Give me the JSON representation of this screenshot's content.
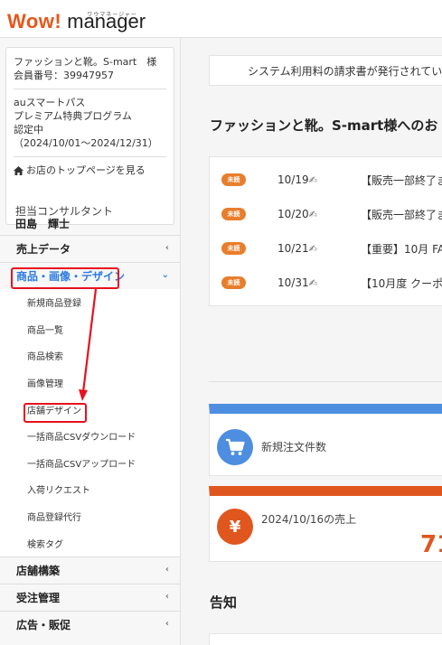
{
  "header": {
    "logo_wow": "Wow!",
    "logo_manager": "manager",
    "logo_ruby": "ワウマネージャー"
  },
  "shop": {
    "name_line": "ファッションと靴。S-mart　様",
    "member_no": "会員番号：39947957",
    "program_line1": "auスマートパス",
    "program_line2": "プレミアム特典プログラム",
    "program_line3": "認定中",
    "program_period": "（2024/10/01～2024/12/31）",
    "top_link": "お店のトップページを見る"
  },
  "consultant": {
    "label": "担当コンサルタント",
    "name": "田島　輝士"
  },
  "menu": {
    "sales": "売上データ",
    "products": "商品・画像・デザイン",
    "sub_items": [
      "新規商品登録",
      "商品一覧",
      "商品検索",
      "画像管理",
      "店舗デザイン",
      "一括商品CSVダウンロード",
      "一括商品CSVアップロード",
      "入荷リクエスト",
      "商品登録代行",
      "検索タグ"
    ],
    "store_build": "店舗構築",
    "orders": "受注管理",
    "ads": "広告・販促"
  },
  "main": {
    "notice": "システム利用料の請求書が発行されてい",
    "welcome": "ファッションと靴。S-mart様へのお",
    "news": [
      {
        "badge": "未読",
        "date": "10/19",
        "title": "【販売一部終了ま"
      },
      {
        "badge": "未読",
        "date": "10/20",
        "title": "【販売一部終了ま"
      },
      {
        "badge": "未読",
        "date": "10/21",
        "title": "【重要】10月 FAS"
      },
      {
        "badge": "未読",
        "date": "10/31",
        "title": "【10月度 クーポン"
      }
    ],
    "new_orders_label": "新規注文件数",
    "sales_label": "2024/10/16の売上",
    "sales_value": "71",
    "yen_symbol": "¥",
    "announce": "告知"
  },
  "colors": {
    "brand_orange": "#e8561c",
    "active_blue": "#2a7ae2",
    "highlight_red": "#e8101e",
    "badge_orange": "#e87e2c",
    "card_blue": "#4d8ee0",
    "card_orange": "#e0561f"
  }
}
